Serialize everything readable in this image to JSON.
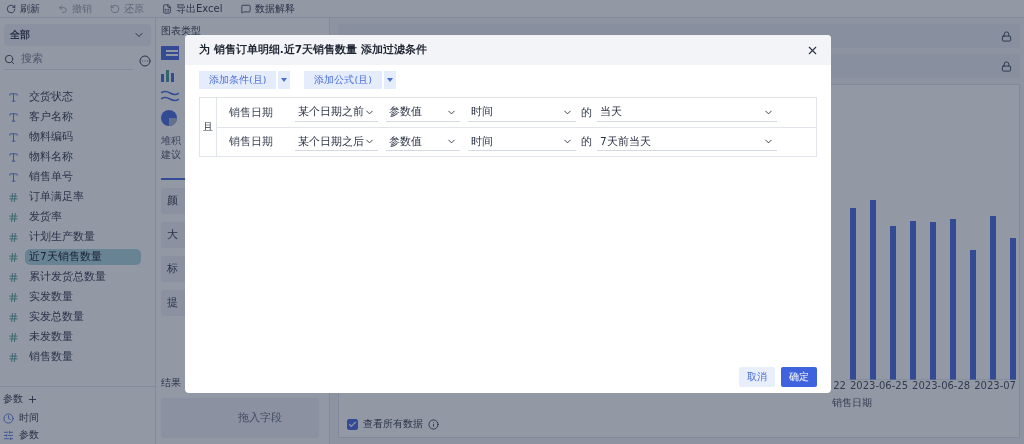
{
  "toolbar": [
    {
      "label": "刷新"
    },
    {
      "label": "撤销"
    },
    {
      "label": "还原"
    },
    {
      "label": "导出Excel"
    },
    {
      "label": "数据解释"
    }
  ],
  "sidebar": {
    "scope": "全部",
    "search_placeholder": "搜索",
    "fields": [
      {
        "label": "交货状态",
        "kind": "text",
        "selected": false
      },
      {
        "label": "客户名称",
        "kind": "text",
        "selected": false
      },
      {
        "label": "物料编码",
        "kind": "text",
        "selected": false
      },
      {
        "label": "物料名称",
        "kind": "text",
        "selected": false
      },
      {
        "label": "销售单号",
        "kind": "text",
        "selected": false
      },
      {
        "label": "订单满足率",
        "kind": "number",
        "selected": false
      },
      {
        "label": "发货率",
        "kind": "number",
        "selected": false
      },
      {
        "label": "计划生产数量",
        "kind": "number",
        "selected": false
      },
      {
        "label": "近7天销售数量",
        "kind": "number",
        "selected": true
      },
      {
        "label": "累计发货总数量",
        "kind": "number",
        "selected": false
      },
      {
        "label": "实发数量",
        "kind": "number",
        "selected": false
      },
      {
        "label": "实发总数量",
        "kind": "number",
        "selected": false
      },
      {
        "label": "未发数量",
        "kind": "number",
        "selected": false
      },
      {
        "label": "销售数量",
        "kind": "number",
        "selected": false
      }
    ],
    "params_title": "参数",
    "params": [
      {
        "label": "时间",
        "kind": "time"
      },
      {
        "label": "参数",
        "kind": "param"
      }
    ]
  },
  "config_panel": {
    "title": "图表类型",
    "note_lines": [
      "堆积",
      "建议"
    ],
    "properties": [
      "颜",
      "大",
      "标",
      "提"
    ],
    "result_title": "结果",
    "drop_hint": "拖入字段"
  },
  "chart": {
    "x_labels": [
      "22",
      "2023-06-25",
      "2023-06-28",
      "2023-07"
    ],
    "x_title": "销售日期"
  },
  "show_all": {
    "label": "查看所有数据",
    "checked": true
  },
  "dialog": {
    "title": "为 销售订单明细.近7天销售数量 添加过滤条件",
    "add_buttons": [
      {
        "label": "添加条件(且)"
      },
      {
        "label": "添加公式(且)"
      }
    ],
    "joiner": "且",
    "conditions": [
      {
        "field": "销售日期",
        "operator": "某个日期之前",
        "value_type": "参数值",
        "param": "时间",
        "connector": "的",
        "value": "当天"
      },
      {
        "field": "销售日期",
        "operator": "某个日期之后",
        "value_type": "参数值",
        "param": "时间",
        "connector": "的",
        "value": "7天前当天"
      }
    ],
    "cancel": "取消",
    "confirm": "确定"
  }
}
